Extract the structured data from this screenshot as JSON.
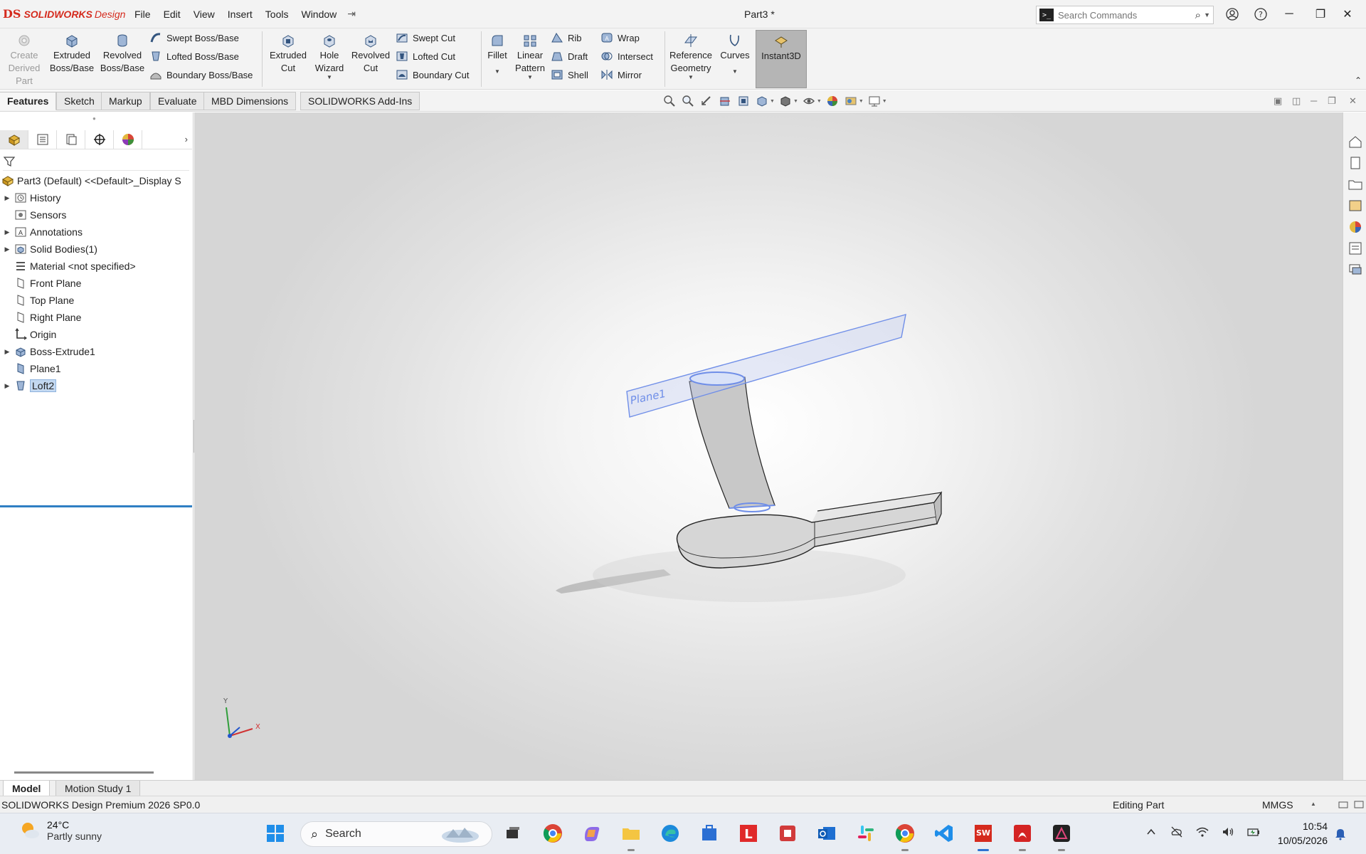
{
  "app": {
    "logo_ds": "DS",
    "logo_brand": "SOLIDWORKS",
    "logo_brand2": "Design",
    "document_title": "Part3 *"
  },
  "menu": [
    "File",
    "Edit",
    "View",
    "Insert",
    "Tools",
    "Window"
  ],
  "search_commands": {
    "placeholder": "Search Commands"
  },
  "ribbon": {
    "create_derived": [
      "Create",
      "Derived",
      "Part"
    ],
    "extruded_boss": [
      "Extruded",
      "Boss/Base"
    ],
    "revolved_boss": [
      "Revolved",
      "Boss/Base"
    ],
    "swept_boss": "Swept Boss/Base",
    "lofted_boss": "Lofted Boss/Base",
    "boundary_boss": "Boundary Boss/Base",
    "extruded_cut": [
      "Extruded",
      "Cut"
    ],
    "hole_wizard": [
      "Hole",
      "Wizard"
    ],
    "revolved_cut": [
      "Revolved",
      "Cut"
    ],
    "swept_cut": "Swept Cut",
    "lofted_cut": "Lofted Cut",
    "boundary_cut": "Boundary Cut",
    "fillet": "Fillet",
    "linear_pattern": [
      "Linear",
      "Pattern"
    ],
    "rib": "Rib",
    "draft": "Draft",
    "shell": "Shell",
    "wrap": "Wrap",
    "intersect": "Intersect",
    "mirror": "Mirror",
    "reference_geometry": [
      "Reference",
      "Geometry"
    ],
    "curves": "Curves",
    "instant3d": "Instant3D"
  },
  "tabs": [
    "Features",
    "Sketch",
    "Markup",
    "Evaluate",
    "MBD Dimensions",
    "SOLIDWORKS Add-Ins"
  ],
  "tree": {
    "root": "Part3 (Default) <<Default>_Display S",
    "items": [
      {
        "label": "History",
        "icon": "history-icon",
        "expandable": true
      },
      {
        "label": "Sensors",
        "icon": "sensors-icon",
        "expandable": false
      },
      {
        "label": "Annotations",
        "icon": "annotations-icon",
        "expandable": true
      },
      {
        "label": "Solid Bodies(1)",
        "icon": "solid-bodies-icon",
        "expandable": true
      },
      {
        "label": "Material <not specified>",
        "icon": "material-icon",
        "expandable": false
      },
      {
        "label": "Front Plane",
        "icon": "plane-icon",
        "expandable": false
      },
      {
        "label": "Top Plane",
        "icon": "plane-icon",
        "expandable": false
      },
      {
        "label": "Right Plane",
        "icon": "plane-icon",
        "expandable": false
      },
      {
        "label": "Origin",
        "icon": "origin-icon",
        "expandable": false
      },
      {
        "label": "Boss-Extrude1",
        "icon": "extrude-feature-icon",
        "expandable": true
      },
      {
        "label": "Plane1",
        "icon": "plane-icon",
        "expandable": false
      },
      {
        "label": "Loft2",
        "icon": "loft-feature-icon",
        "expandable": true,
        "selected": true
      }
    ]
  },
  "viewport": {
    "plane_label": "Plane1",
    "triad_y": "Y",
    "triad_x": "X"
  },
  "bottom_tabs": [
    "Model",
    "Motion Study 1"
  ],
  "status": {
    "product": "SOLIDWORKS Design Premium 2026 SP0.0",
    "mode": "Editing Part",
    "units": "MMGS"
  },
  "taskbar": {
    "temperature": "24°C",
    "weather": "Partly sunny",
    "search_label": "Search",
    "time": "10:54",
    "date": "10/05/2026"
  },
  "colors": {
    "brand_red": "#d52b1e",
    "selection_blue": "#2f7fc3",
    "plane_blue": "#6f8ee8"
  }
}
